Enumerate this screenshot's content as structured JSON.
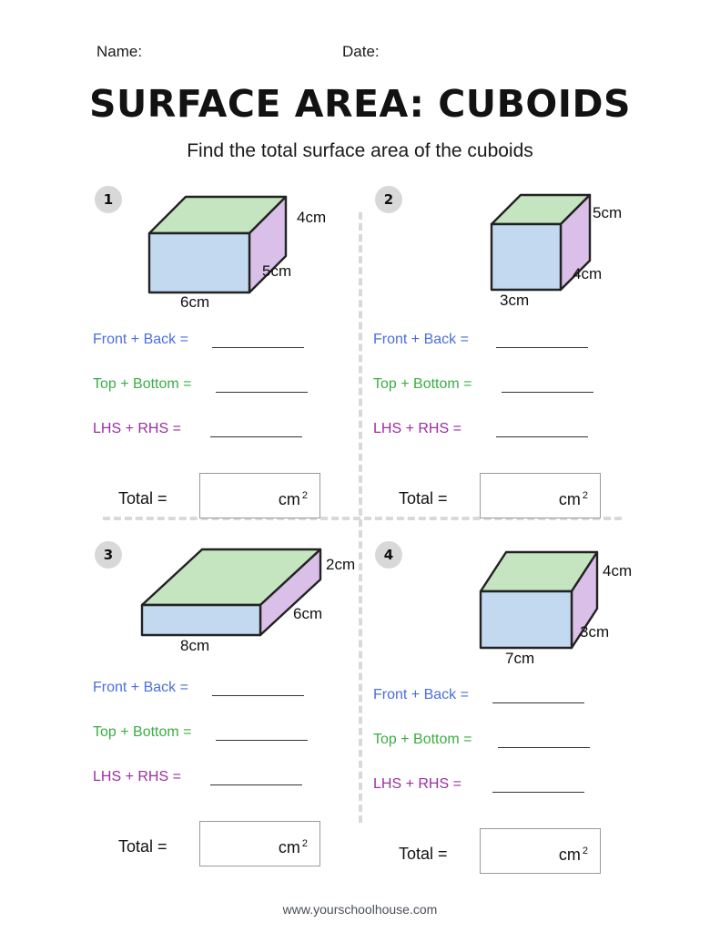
{
  "header": {
    "name_label": "Name:",
    "date_label": "Date:",
    "title": "SURFACE AREA: CUBOIDS",
    "subtitle": "Find the total surface area of the cuboids"
  },
  "labels": {
    "front_back": "Front + Back =",
    "top_bottom": "Top + Bottom =",
    "lhs_rhs": "LHS + RHS =",
    "total": "Total =",
    "unit": "cm",
    "unit_exponent": "2"
  },
  "colors": {
    "front_face": "#c3d9ef",
    "top_face": "#c4e5bf",
    "side_face": "#dabfe8",
    "outline": "#222222",
    "front_back_text": "#4a6ee0",
    "top_bottom_text": "#3aad45",
    "lhs_rhs_text": "#9b2fa0",
    "badge_bg": "#d8d8d8",
    "divider": "#d9d9d9"
  },
  "problems": [
    {
      "number": "1",
      "width_label": "6cm",
      "height_label": "4cm",
      "depth_label": "5cm",
      "width_cm": 6,
      "height_cm": 4,
      "depth_cm": 5
    },
    {
      "number": "2",
      "width_label": "3cm",
      "height_label": "5cm",
      "depth_label": "4cm",
      "width_cm": 3,
      "height_cm": 5,
      "depth_cm": 4
    },
    {
      "number": "3",
      "width_label": "8cm",
      "height_label": "2cm",
      "depth_label": "6cm",
      "width_cm": 8,
      "height_cm": 2,
      "depth_cm": 6
    },
    {
      "number": "4",
      "width_label": "7cm",
      "height_label": "4cm",
      "depth_label": "3cm",
      "width_cm": 7,
      "height_cm": 4,
      "depth_cm": 3
    }
  ],
  "footer": {
    "url": "www.yourschoolhouse.com"
  }
}
